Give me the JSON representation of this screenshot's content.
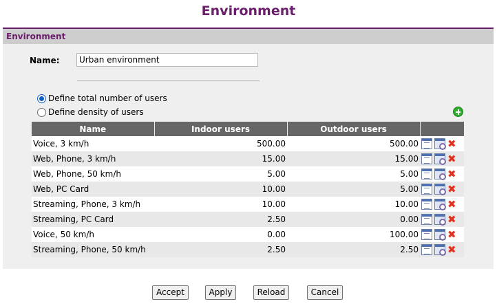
{
  "page": {
    "title": "Environment"
  },
  "panel": {
    "header": "Environment"
  },
  "form": {
    "name_label": "Name:",
    "name_value": "Urban environment"
  },
  "mode": {
    "options": [
      {
        "label": "Define total number of users",
        "checked": true
      },
      {
        "label": "Define density of users",
        "checked": false
      }
    ]
  },
  "icons": {
    "add": "add-icon",
    "edit": "doc-icon",
    "settings": "settings-icon",
    "delete": "delete-icon"
  },
  "table": {
    "headers": [
      "Name",
      "Indoor users",
      "Outdoor users",
      ""
    ],
    "rows": [
      {
        "name": "Voice, 3 km/h",
        "indoor": "500.00",
        "outdoor": "500.00"
      },
      {
        "name": "Web, Phone, 3 km/h",
        "indoor": "15.00",
        "outdoor": "15.00"
      },
      {
        "name": "Web, Phone, 50 km/h",
        "indoor": "5.00",
        "outdoor": "5.00"
      },
      {
        "name": "Web, PC Card",
        "indoor": "10.00",
        "outdoor": "5.00"
      },
      {
        "name": "Streaming, Phone, 3 km/h",
        "indoor": "10.00",
        "outdoor": "10.00"
      },
      {
        "name": "Streaming, PC Card",
        "indoor": "2.50",
        "outdoor": "0.00"
      },
      {
        "name": "Voice, 50 km/h",
        "indoor": "0.00",
        "outdoor": "100.00"
      },
      {
        "name": "Streaming, Phone, 50 km/h",
        "indoor": "2.50",
        "outdoor": "2.50"
      }
    ]
  },
  "buttons": {
    "accept": "Accept",
    "apply": "Apply",
    "reload": "Reload",
    "cancel": "Cancel"
  },
  "colors": {
    "accent": "#6b1e6b",
    "table_header": "#666666",
    "panel_bg": "#efefef",
    "delete": "#e2301c",
    "add": "#2fae2f"
  }
}
